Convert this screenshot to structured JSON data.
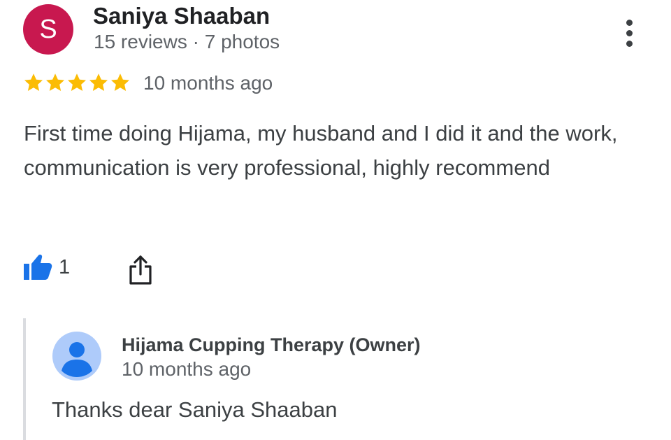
{
  "review": {
    "author": {
      "initial": "S",
      "name": "Saniya Shaaban",
      "meta": "15 reviews · 7 photos",
      "avatar_color": "#c8184f"
    },
    "rating": 5,
    "rating_max": 5,
    "star_color": "#fbbc04",
    "time": "10 months ago",
    "text": "First time doing Hijama, my husband and I did it and the work, communication is very professional, highly recommend",
    "likes": "1",
    "like_color": "#1a73e8",
    "more_icon": "more-vert-icon",
    "like_icon": "thumb-up-icon",
    "share_icon": "share-icon"
  },
  "owner_reply": {
    "name": "Hijama Cupping Therapy (Owner)",
    "time": "10 months ago",
    "text": "Thanks dear Saniya Shaaban",
    "avatar_icon": "person-icon",
    "avatar_color": "#aecbfa"
  }
}
